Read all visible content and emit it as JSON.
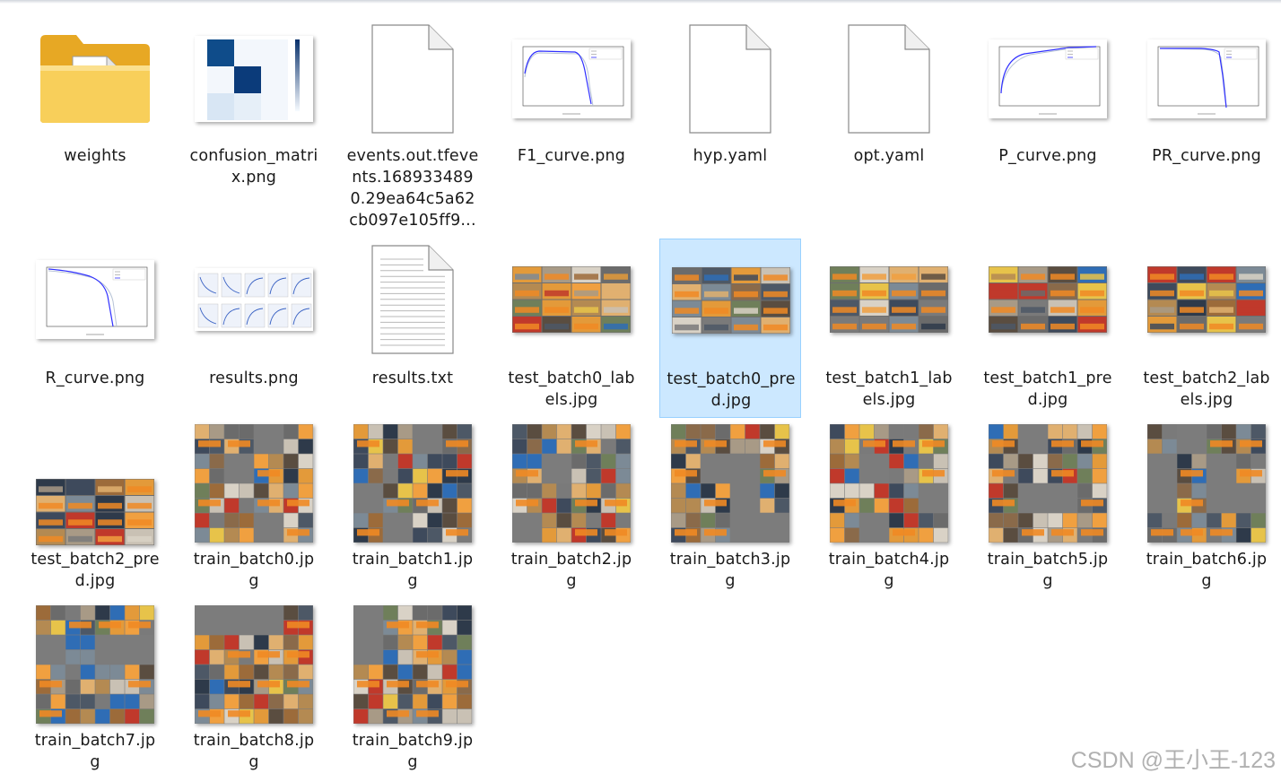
{
  "watermark": "CSDN @王小王-123",
  "files": [
    {
      "lines": [
        "weights"
      ],
      "icon": "folder-icon"
    },
    {
      "lines": [
        "confusion_matri",
        "x.png"
      ],
      "icon": "confusion-matrix-thumbnail"
    },
    {
      "lines": [
        "events.out.tfeve",
        "nts.168933489",
        "0.29ea64c5a62",
        "cb097e105ff9..."
      ],
      "icon": "blank-file-icon"
    },
    {
      "lines": [
        "F1_curve.png"
      ],
      "icon": "f1-curve-thumbnail"
    },
    {
      "lines": [
        "hyp.yaml"
      ],
      "icon": "blank-file-icon"
    },
    {
      "lines": [
        "opt.yaml"
      ],
      "icon": "blank-file-icon"
    },
    {
      "lines": [
        "P_curve.png"
      ],
      "icon": "p-curve-thumbnail"
    },
    {
      "lines": [
        "PR_curve.png"
      ],
      "icon": "pr-curve-thumbnail"
    },
    {
      "lines": [
        "R_curve.png"
      ],
      "icon": "r-curve-thumbnail"
    },
    {
      "lines": [
        "results.png"
      ],
      "icon": "results-thumbnail"
    },
    {
      "lines": [
        "results.txt"
      ],
      "icon": "text-file-icon"
    },
    {
      "lines": [
        "test_batch0_lab",
        "els.jpg"
      ],
      "icon": "batch-thumbnail"
    },
    {
      "lines": [
        "test_batch0_pre",
        "d.jpg"
      ],
      "icon": "batch-thumbnail",
      "selected": true
    },
    {
      "lines": [
        "test_batch1_lab",
        "els.jpg"
      ],
      "icon": "batch-thumbnail"
    },
    {
      "lines": [
        "test_batch1_pre",
        "d.jpg"
      ],
      "icon": "batch-thumbnail"
    },
    {
      "lines": [
        "test_batch2_lab",
        "els.jpg"
      ],
      "icon": "batch-thumbnail"
    },
    {
      "lines": [
        "test_batch2_pre",
        "d.jpg"
      ],
      "icon": "batch-thumbnail"
    },
    {
      "lines": [
        "train_batch0.jp",
        "g"
      ],
      "icon": "mosaic-thumbnail"
    },
    {
      "lines": [
        "train_batch1.jp",
        "g"
      ],
      "icon": "mosaic-thumbnail"
    },
    {
      "lines": [
        "train_batch2.jp",
        "g"
      ],
      "icon": "mosaic-thumbnail"
    },
    {
      "lines": [
        "train_batch3.jp",
        "g"
      ],
      "icon": "mosaic-thumbnail"
    },
    {
      "lines": [
        "train_batch4.jp",
        "g"
      ],
      "icon": "mosaic-thumbnail"
    },
    {
      "lines": [
        "train_batch5.jp",
        "g"
      ],
      "icon": "mosaic-thumbnail"
    },
    {
      "lines": [
        "train_batch6.jp",
        "g"
      ],
      "icon": "mosaic-thumbnail"
    },
    {
      "lines": [
        "train_batch7.jp",
        "g"
      ],
      "icon": "mosaic-thumbnail"
    },
    {
      "lines": [
        "train_batch8.jp",
        "g"
      ],
      "icon": "mosaic-thumbnail"
    },
    {
      "lines": [
        "train_batch9.jp",
        "g"
      ],
      "icon": "mosaic-thumbnail"
    }
  ],
  "colors": {
    "selection_bg": "#cce8ff",
    "selection_border": "#99d1ff",
    "folder": "#f6c64a",
    "chart_line": "#3030ff",
    "matrix_dark": "#0b3b7a"
  }
}
